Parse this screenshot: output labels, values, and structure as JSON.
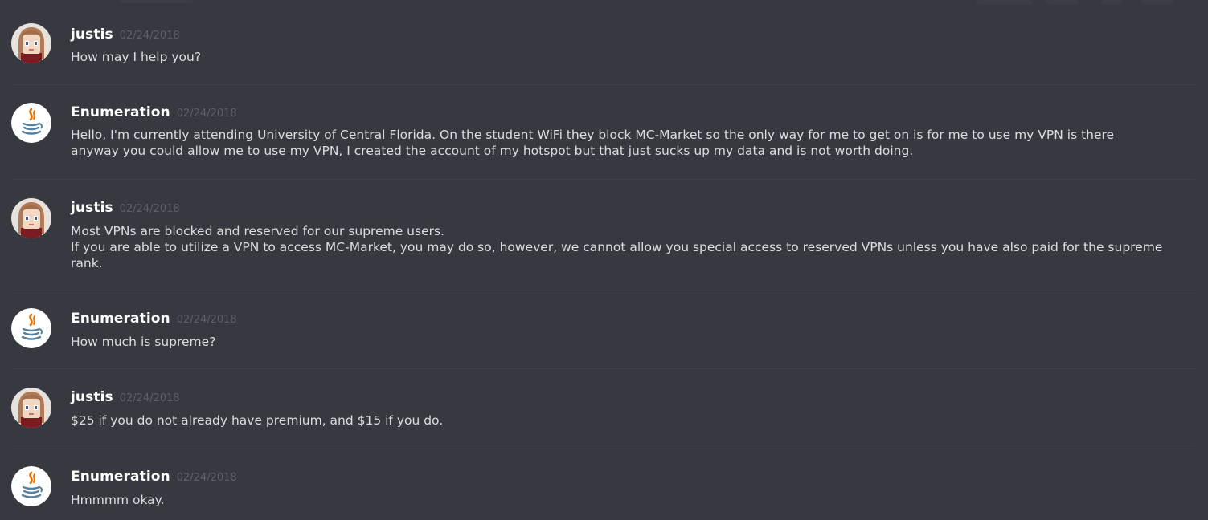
{
  "colors": {
    "background": "#36393f",
    "username": "#ffffff",
    "timestamp": "#5d6066",
    "message_text": "#dcddde",
    "divider": "#3e4147"
  },
  "messages": [
    {
      "author": "justis",
      "timestamp": "02/24/2018",
      "avatar_icon": "anime-girl-avatar-icon",
      "lines": [
        "How may I help you?"
      ]
    },
    {
      "author": "Enumeration",
      "timestamp": "02/24/2018",
      "avatar_icon": "java-coffee-cup-avatar-icon",
      "lines": [
        "Hello, I'm currently attending University of Central Florida. On the student WiFi they block MC-Market so the only way for me to get on is for me to use my VPN is there",
        "anyway you could allow me to use my VPN, I created the account of my hotspot but that just sucks up my data and is not worth doing."
      ]
    },
    {
      "author": "justis",
      "timestamp": "02/24/2018",
      "avatar_icon": "anime-girl-avatar-icon",
      "lines": [
        "Most VPNs are blocked and reserved for our supreme users.",
        "If you are able to utilize a VPN to access MC-Market, you may do so, however, we cannot allow you special access to reserved VPNs unless you have also paid for the supreme",
        "rank."
      ]
    },
    {
      "author": "Enumeration",
      "timestamp": "02/24/2018",
      "avatar_icon": "java-coffee-cup-avatar-icon",
      "lines": [
        "How much is supreme?"
      ]
    },
    {
      "author": "justis",
      "timestamp": "02/24/2018",
      "avatar_icon": "anime-girl-avatar-icon",
      "lines": [
        "$25 if you do not already have premium, and $15 if you do."
      ]
    },
    {
      "author": "Enumeration",
      "timestamp": "02/24/2018",
      "avatar_icon": "java-coffee-cup-avatar-icon",
      "lines": [
        "Hmmmm okay."
      ]
    }
  ]
}
